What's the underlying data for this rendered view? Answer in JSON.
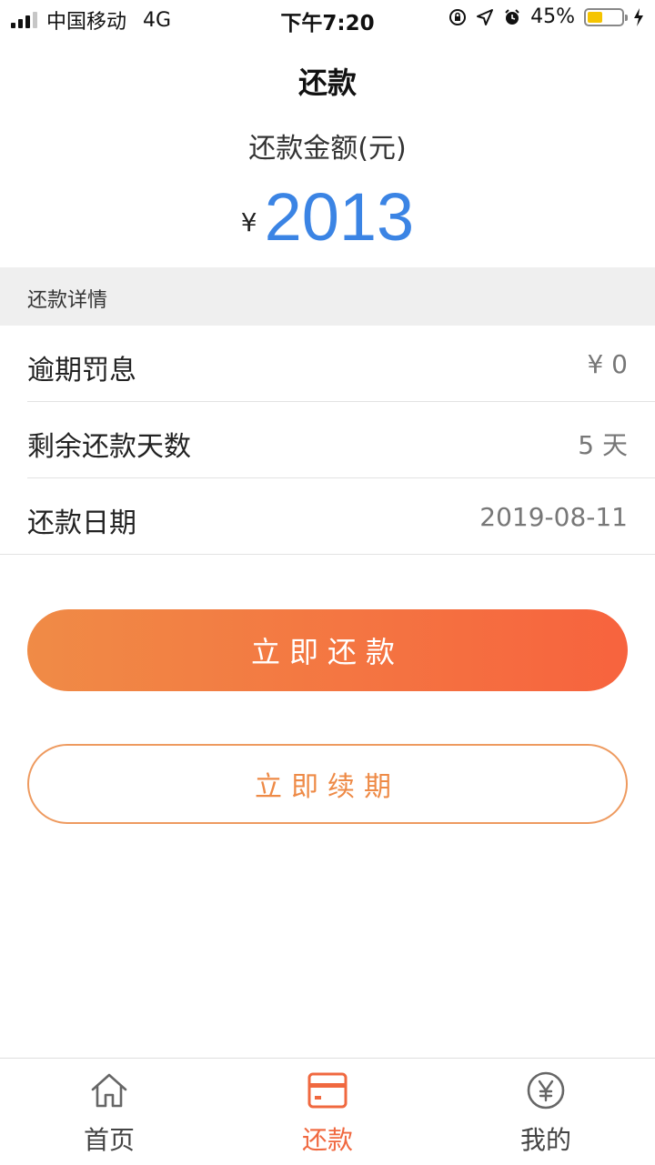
{
  "status_bar": {
    "carrier": "中国移动",
    "network": "4G",
    "time": "下午7:20",
    "battery_percent": "45%",
    "battery_level": 0.45
  },
  "header": {
    "title": "还款",
    "amount_label": "还款金额(元)",
    "currency_symbol": "¥",
    "amount": "2013",
    "amount_color": "#3b84e4"
  },
  "details": {
    "section_title": "还款详情",
    "rows": [
      {
        "label": "逾期罚息",
        "value": "¥ 0"
      },
      {
        "label": "剩余还款天数",
        "value": "5 天"
      },
      {
        "label": "还款日期",
        "value": "2019-08-11"
      }
    ]
  },
  "actions": {
    "repay_label": "立即还款",
    "renew_label": "立即续期",
    "accent_start": "#f08b46",
    "accent_end": "#f7633e"
  },
  "tabs": [
    {
      "label": "首页",
      "icon": "home-icon",
      "active": false
    },
    {
      "label": "还款",
      "icon": "card-icon",
      "active": true
    },
    {
      "label": "我的",
      "icon": "yen-circle-icon",
      "active": false
    }
  ]
}
